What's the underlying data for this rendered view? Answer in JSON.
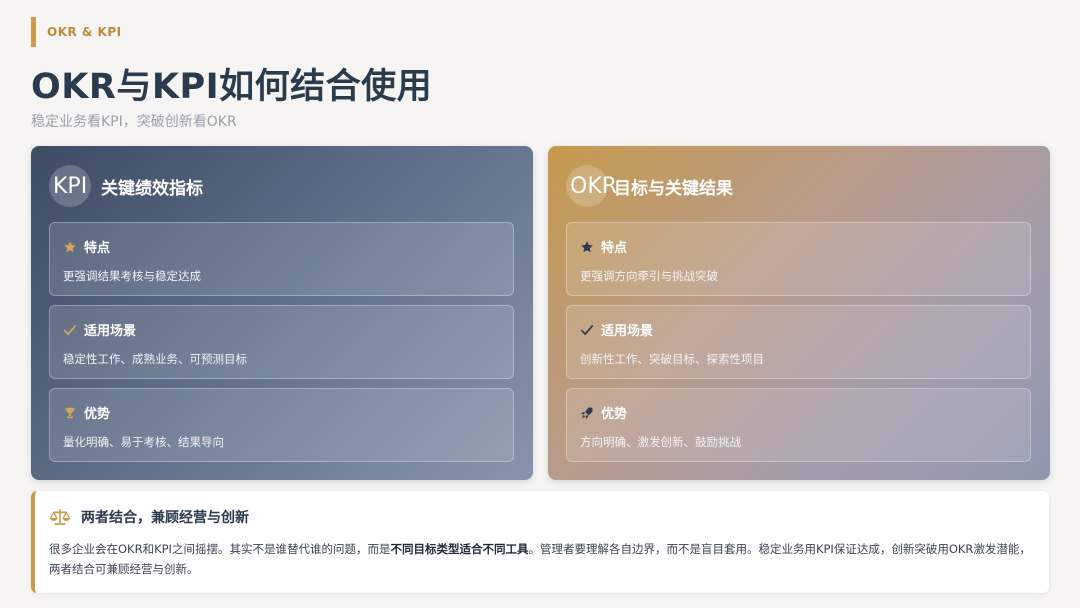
{
  "tag": "OKR & KPI",
  "title": "OKR与KPI如何结合使用",
  "subtitle": "稳定业务看KPI，突破创新看OKR",
  "colors": {
    "accent": "#c89a4b",
    "title": "#2b3b4e"
  },
  "kpi": {
    "logo": "KPI",
    "heading": "关键绩效指标",
    "items": [
      {
        "icon": "star-icon",
        "title": "特点",
        "text": "更强调结果考核与稳定达成"
      },
      {
        "icon": "check-icon",
        "title": "适用场景",
        "text": "稳定性工作、成熟业务、可预测目标"
      },
      {
        "icon": "trophy-icon",
        "title": "优势",
        "text": "量化明确、易于考核、结果导向"
      }
    ]
  },
  "okr": {
    "logo": "OKR",
    "heading": "目标与关键结果",
    "items": [
      {
        "icon": "star-icon",
        "title": "特点",
        "text": "更强调方向牵引与挑战突破"
      },
      {
        "icon": "check-icon",
        "title": "适用场景",
        "text": "创新性工作、突破目标、探索性项目"
      },
      {
        "icon": "rocket-icon",
        "title": "优势",
        "text": "方向明确、激发创新、鼓励挑战"
      }
    ]
  },
  "summary": {
    "icon": "balance-scale-icon",
    "title": "两者结合，兼顾经营与创新",
    "body_pre": "很多企业会在OKR和KPI之间摇摆。其实不是谁替代谁的问题，而是",
    "body_bold": "不同目标类型适合不同工具",
    "body_post": "。管理者要理解各自边界，而不是盲目套用。稳定业务用KPI保证达成，创新突破用OKR激发潜能，两者结合可兼顾经营与创新。"
  }
}
